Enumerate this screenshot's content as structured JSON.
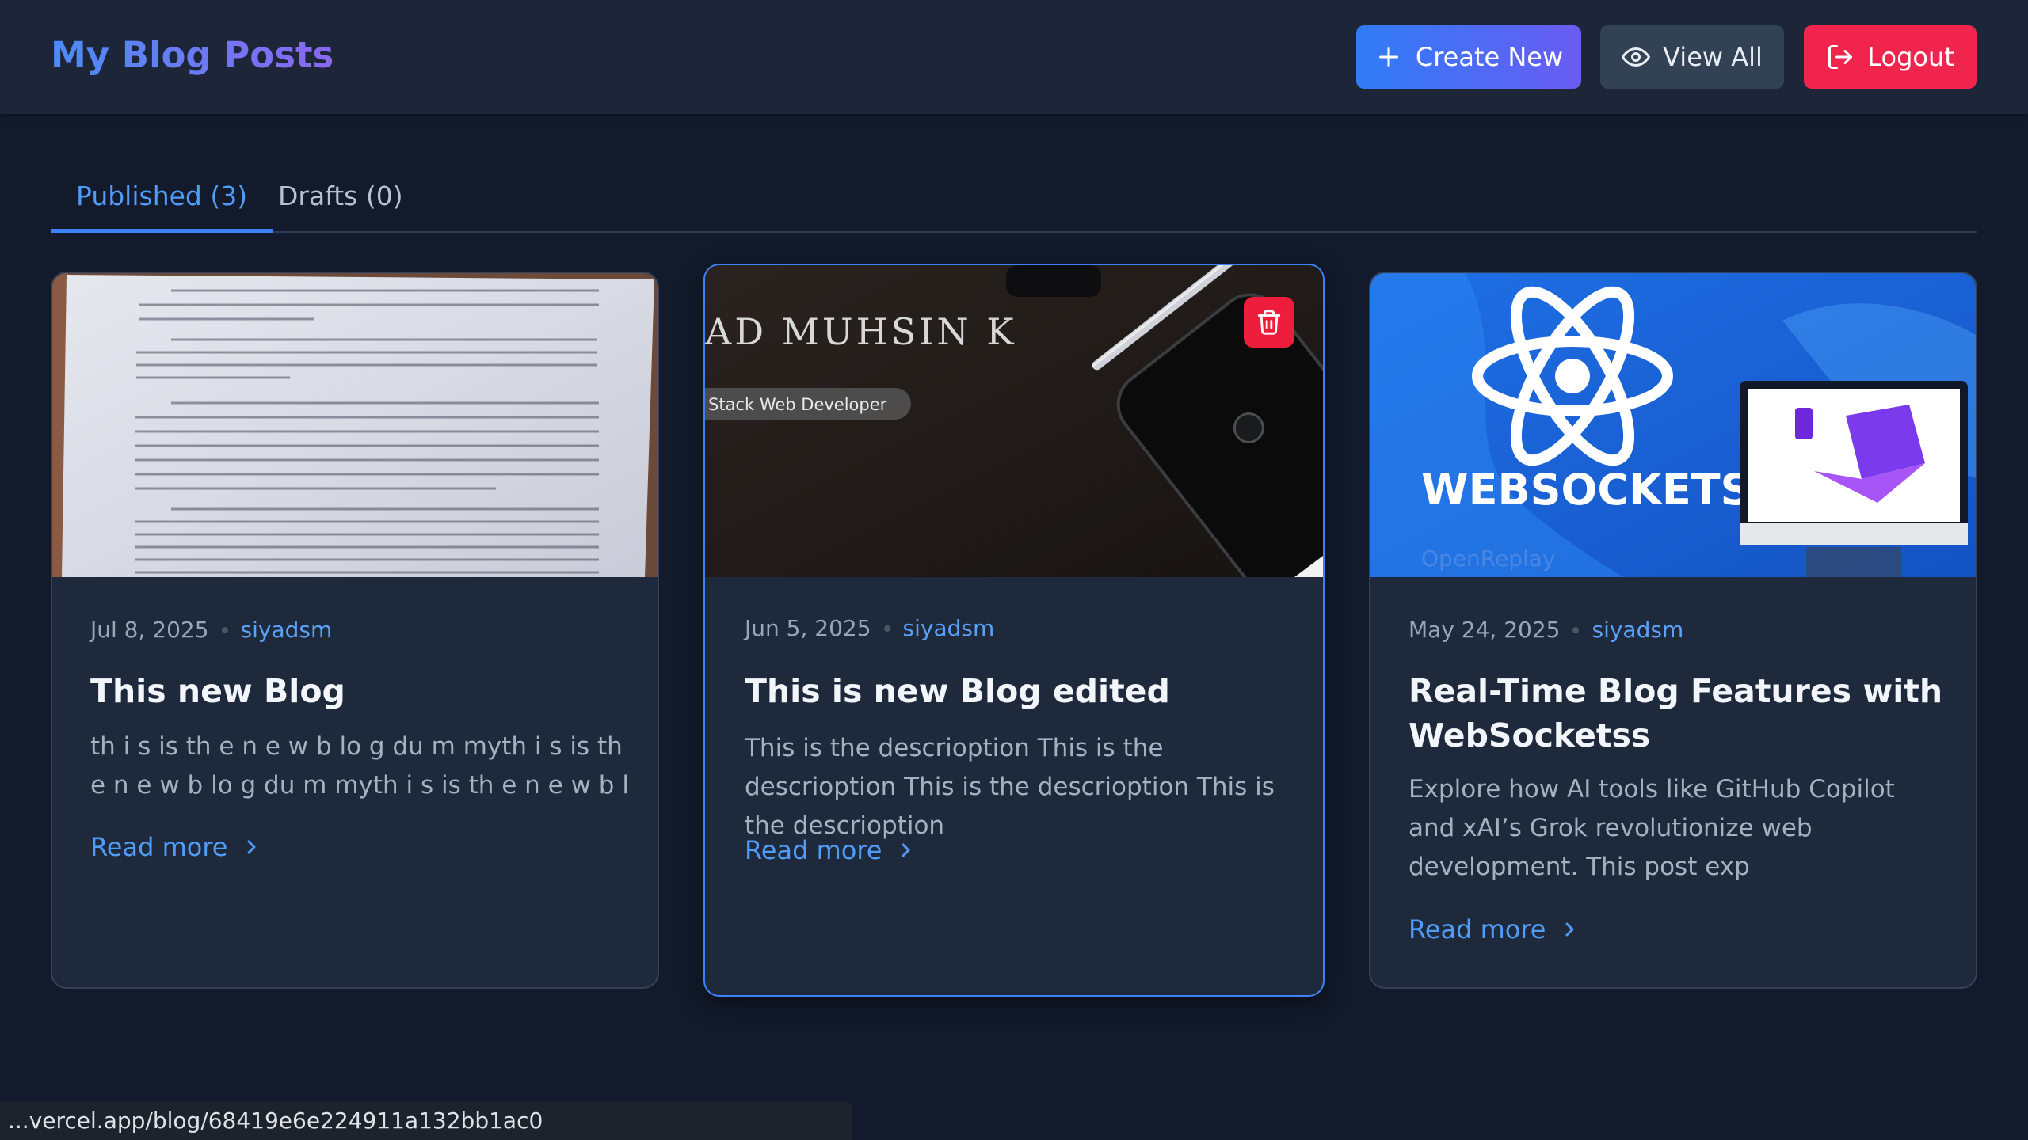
{
  "header": {
    "title": "My Blog Posts",
    "create_label": "Create New",
    "view_label": "View All",
    "logout_label": "Logout",
    "accent_gradient": [
      "#2f7cf6",
      "#6a5cf3"
    ],
    "logout_color": "#f0244d"
  },
  "tabs": [
    {
      "label": "Published (3)",
      "active": true
    },
    {
      "label": "Drafts (0)",
      "active": false
    }
  ],
  "posts": [
    {
      "date": "Jul 8, 2025",
      "author": "siyadsm",
      "title": "This new Blog",
      "excerpt": "th i s is th e n e w b lo g du m myth i s is th e n e w b lo g du m myth i s is th e n e w b l",
      "read_more": "Read more",
      "image": "scanned-document"
    },
    {
      "date": "Jun 5, 2025",
      "author": "siyadsm",
      "title": "This is new Blog edited",
      "excerpt": "This is the descrioption This is the descrioption This is the descrioption This is the descrioption",
      "read_more": "Read more",
      "image": "desk-phone-pen",
      "image_text": [
        "AD MUHSIN K",
        "Stack Web Developer"
      ]
    },
    {
      "date": "May 24, 2025",
      "author": "siyadsm",
      "title": "Real-Time Blog Features with WebSocketss",
      "excerpt": "Explore how AI tools like GitHub Copilot and xAI’s Grok revolutionize web development. This post exp",
      "read_more": "Read more",
      "image": "websockets-banner",
      "image_text": [
        "WEBSOCKETS",
        "OpenReplay"
      ]
    }
  ],
  "status_bar": {
    "url": "...vercel.app/blog/68419e6e224911a132bb1ac0"
  }
}
